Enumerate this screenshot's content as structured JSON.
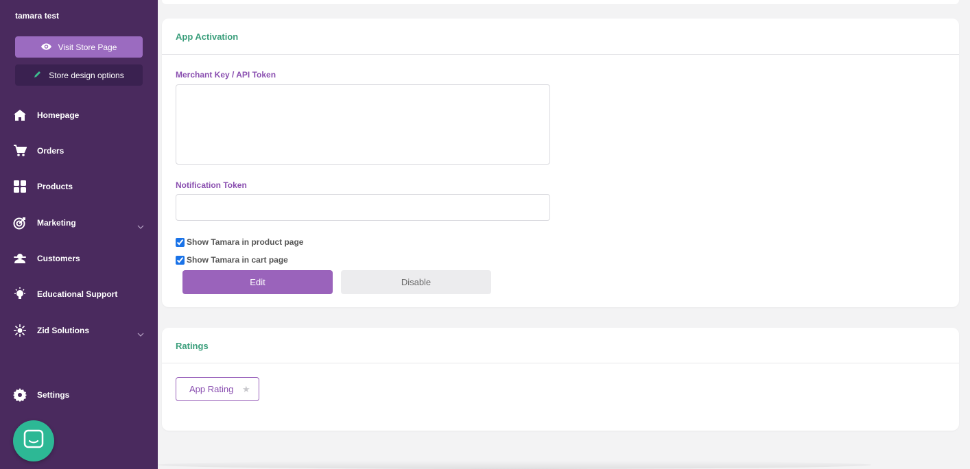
{
  "sidebar": {
    "store_name": "tamara test",
    "visit_store": "Visit Store Page",
    "design_options": "Store design options",
    "items": [
      {
        "label": "Homepage",
        "icon": "home-icon"
      },
      {
        "label": "Orders",
        "icon": "cart-icon"
      },
      {
        "label": "Products",
        "icon": "grid-icon"
      },
      {
        "label": "Marketing",
        "icon": "target-icon",
        "expandable": true
      },
      {
        "label": "Customers",
        "icon": "customer-icon"
      },
      {
        "label": "Educational Support",
        "icon": "lightbulb-icon"
      },
      {
        "label": "Zid Solutions",
        "icon": "sparkle-icon",
        "expandable": true
      },
      {
        "label": "Settings",
        "icon": "gear-icon"
      }
    ]
  },
  "activation": {
    "title": "App Activation",
    "merchant_key_label": "Merchant Key / API Token",
    "merchant_key_value": "",
    "notification_token_label": "Notification Token",
    "notification_token_value": "",
    "show_product_label": "Show Tamara in product page",
    "show_product_checked": true,
    "show_cart_label": "Show Tamara in cart page",
    "show_cart_checked": true,
    "edit_label": "Edit",
    "disable_label": "Disable"
  },
  "ratings": {
    "title": "Ratings",
    "app_rating_label": "App Rating"
  },
  "colors": {
    "sidebar_bg": "#4a2a5e",
    "accent_purple": "#9a63bb",
    "title_green": "#3a9e7b",
    "chat_green": "#2db895"
  }
}
